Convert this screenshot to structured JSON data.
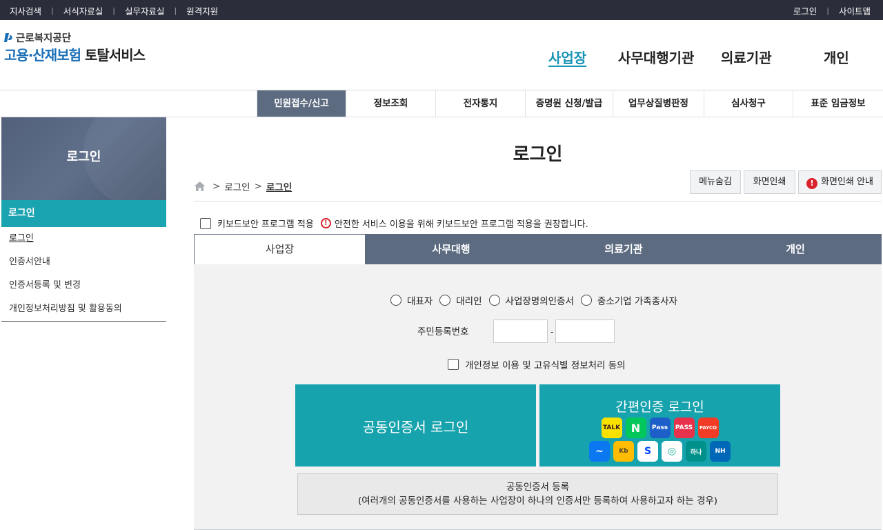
{
  "utilbar": {
    "left_links": [
      "지사검색",
      "서식자료실",
      "실무자료실",
      "원격지원"
    ],
    "right_links": [
      "로그인",
      "사이트맵"
    ],
    "separator": "|"
  },
  "logo": {
    "org": "근로복지공단",
    "title_a": "고용·산재보험",
    "title_b": "토탈서비스"
  },
  "gnb": [
    "사업장",
    "사무대행기관",
    "의료기관",
    "개인"
  ],
  "submenu": [
    "민원접수/신고",
    "정보조회",
    "전자통지",
    "증명원 신청/발급",
    "업무상질병판정",
    "심사청구",
    "표준 임금정보"
  ],
  "lnb": {
    "title": "로그인",
    "current": "로그인",
    "items": [
      "로그인",
      "인증서안내",
      "인증서등록 및 변경",
      "개인정보처리방침 및 활용동의"
    ]
  },
  "content": {
    "title": "로그인",
    "breadcrumb": [
      "로그인",
      "로그인"
    ],
    "breadcrumb_sep": ">",
    "buttons": [
      "메뉴숨김",
      "화면인쇄",
      "화면인쇄 안내"
    ],
    "alert_glyph": "!",
    "keyboard_label": "키보드보안 프로그램 적용",
    "keyboard_notice": "안전한 서비스 이용을 위해 키보드보안 프로그램 적용을 권장합니다.",
    "tabs": [
      "사업장",
      "사무대행",
      "의료기관",
      "개인"
    ],
    "radio_options": [
      "대표자",
      "대리인",
      "사업장명의인증서",
      "중소기업 가족종사자"
    ],
    "rrn_label": "주민등록번호",
    "rrn_dash": "-",
    "consent_label": "개인정보 이용 및 고유식별 정보처리 동의",
    "cert_login": "공동인증서 로그인",
    "easy_login": "간편인증 로그인",
    "easy_icons_row1": [
      "TALK",
      "N",
      "Pass",
      "PASS",
      "PAYCO"
    ],
    "easy_icons_row2": [
      "~",
      "Kb",
      "S",
      "◎",
      "하나",
      "NH"
    ],
    "register_title": "공동인증서 등록",
    "register_desc": "(여러개의 공동인증서를 사용하는 사업장이 하나의 인증서만 등록하여 사용하고자 하는 경우)"
  },
  "colors": {
    "topbar": "#2b2e3a",
    "accent_teal": "#17a3ad",
    "nav_slate": "#5c6b80",
    "brand_blue": "#1a6fb7",
    "alert_red": "#d9232d"
  }
}
